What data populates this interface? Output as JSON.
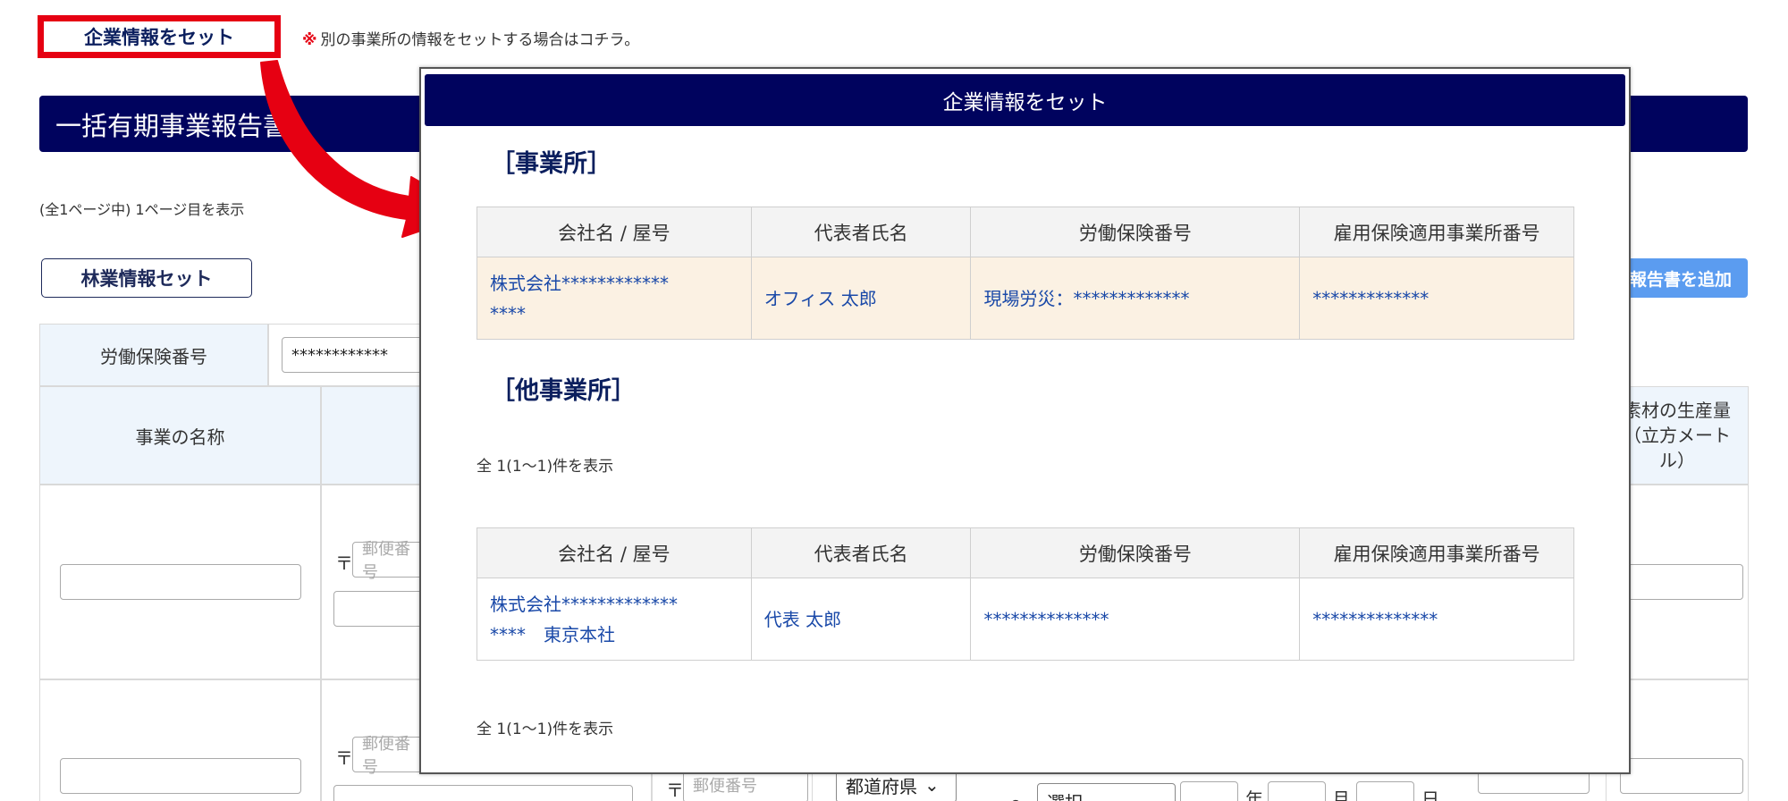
{
  "top": {
    "set_company_button": "企業情報をセット",
    "note_mark": "※",
    "note_text": "別の事業所の情報をセットする場合はコチラ。"
  },
  "background": {
    "header_title": "一括有期事業報告書",
    "page_info": "(全1ページ中) 1ページ目を表示",
    "forestry_button": "林業情報セット",
    "add_report_button": "報告書を追加",
    "labor_insurance_label": "労働保険番号",
    "labor_insurance_value": "************",
    "project_name_header": "事業の名称",
    "timber_header": "素材の生産量（立方メートル）",
    "postal_mark": "〒",
    "postal_placeholder": "郵便番号",
    "prefecture_select": "都道府県",
    "range_mark": "～",
    "select_placeholder": "選択",
    "year_label": "年",
    "month_label": "月",
    "day_label": "日"
  },
  "modal": {
    "title": "企業情報をセット",
    "office_section": "［事業所］",
    "other_section": "［他事業所］",
    "columns": [
      "会社名 / 屋号",
      "代表者氏名",
      "労働保険番号",
      "雇用保険適用事業所番号"
    ],
    "office_rows": [
      {
        "company_line1": "株式会社************",
        "company_line2": "****",
        "representative": "オフィス 太郎",
        "labor_insurance": "現場労災：*************",
        "employment_insurance": "*************"
      }
    ],
    "other_count": "全 1(1～1)件を表示",
    "other_rows": [
      {
        "company_line1": "株式会社*************",
        "company_line2": "****　東京本社",
        "representative": "代表 太郎",
        "labor_insurance": "**************",
        "employment_insurance": "**************"
      }
    ],
    "bottom_count": "全 1(1～1)件を表示"
  },
  "colors": {
    "header_navy": "#00035e",
    "highlight_red": "#e60012",
    "link_blue": "#1a49a8",
    "row_highlight": "#fbf1e3",
    "add_button_blue": "#5b9cf0"
  }
}
